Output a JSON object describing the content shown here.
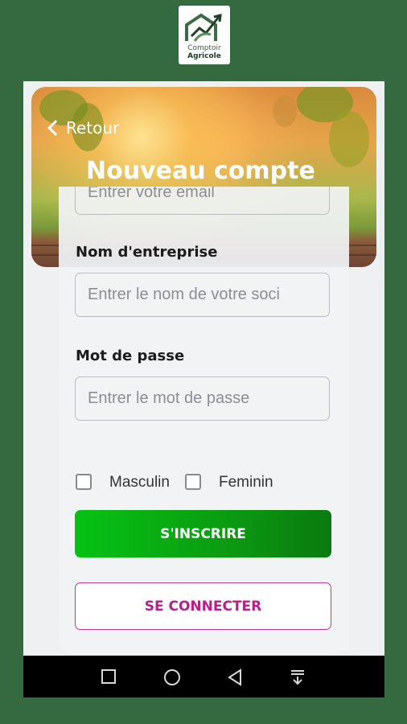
{
  "logo": {
    "line1": "Comptoir",
    "line2": "Agricole"
  },
  "header": {
    "back_label": "Retour",
    "title": "Nouveau compte"
  },
  "form": {
    "email_placeholder": "Entrer votre email",
    "company_label": "Nom d'entreprise",
    "company_placeholder": "Entrer le nom de votre soci",
    "password_label": "Mot de passe",
    "password_placeholder": "Entrer le mot de passe",
    "gender_options": [
      "Masculin",
      "Feminin"
    ],
    "signup_label": "S'INSCRIRE",
    "login_label": "SE CONNECTER"
  },
  "navbar": {
    "icons": [
      "square-recents-icon",
      "circle-home-icon",
      "triangle-back-icon",
      "notification-tray-icon"
    ]
  },
  "colors": {
    "background": "#356a40",
    "primary_green": "#0c9a12",
    "accent_magenta": "#b5218a"
  }
}
